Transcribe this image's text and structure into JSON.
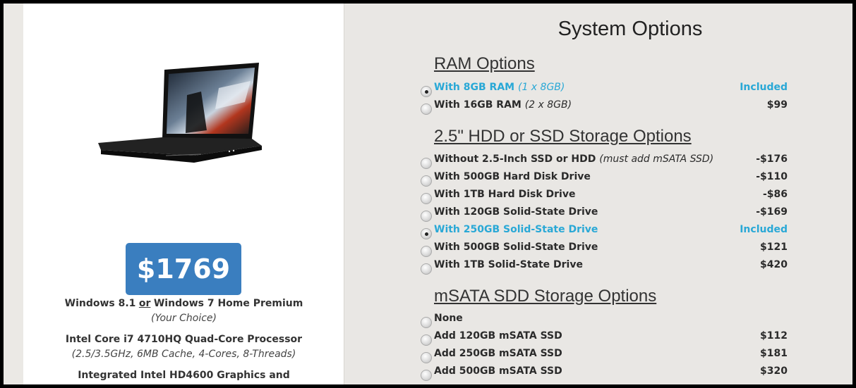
{
  "product": {
    "price": "$1769",
    "os_line_a": "Windows 8.1",
    "os_or": "or",
    "os_line_b": "Windows 7 Home Premium",
    "os_note": "(Your Choice)",
    "cpu": "Intel Core i7 4710HQ Quad-Core Processor",
    "cpu_note": "(2.5/3.5GHz, 6MB Cache, 4-Cores, 8-Threads)",
    "graphics": "Integrated Intel HD4600 Graphics and"
  },
  "page_title": "System Options",
  "sections": [
    {
      "title": "RAM Options",
      "options": [
        {
          "label": "With 8GB RAM",
          "note": "(1 x 8GB)",
          "price": "Included",
          "selected": true
        },
        {
          "label": "With 16GB RAM",
          "note": "(2 x 8GB)",
          "price": "$99",
          "selected": false
        }
      ]
    },
    {
      "title": "2.5\" HDD or SSD Storage Options",
      "options": [
        {
          "label": "Without 2.5-Inch SSD or HDD",
          "note": "(must add mSATA SSD)",
          "price": "-$176",
          "selected": false
        },
        {
          "label": "With 500GB Hard Disk Drive",
          "note": "",
          "price": "-$110",
          "selected": false
        },
        {
          "label": "With 1TB Hard Disk Drive",
          "note": "",
          "price": "-$86",
          "selected": false
        },
        {
          "label": "With 120GB Solid-State Drive",
          "note": "",
          "price": "-$169",
          "selected": false
        },
        {
          "label": "With 250GB Solid-State Drive",
          "note": "",
          "price": "Included",
          "selected": true
        },
        {
          "label": "With 500GB Solid-State Drive",
          "note": "",
          "price": "$121",
          "selected": false
        },
        {
          "label": "With 1TB Solid-State Drive",
          "note": "",
          "price": "$420",
          "selected": false
        }
      ]
    },
    {
      "title": "mSATA SDD Storage Options",
      "options": [
        {
          "label": "None",
          "note": "",
          "price": "",
          "selected": false
        },
        {
          "label": "Add 120GB mSATA SSD",
          "note": "",
          "price": "$112",
          "selected": false
        },
        {
          "label": "Add 250GB mSATA SSD",
          "note": "",
          "price": "$181",
          "selected": false
        },
        {
          "label": "Add 500GB mSATA SSD",
          "note": "",
          "price": "$320",
          "selected": false
        }
      ]
    }
  ],
  "colors": {
    "accent": "#29a8d6",
    "price_badge": "#3a7ebf"
  },
  "icons": {
    "product_image": "laptop-image",
    "radio": "radio-button"
  }
}
